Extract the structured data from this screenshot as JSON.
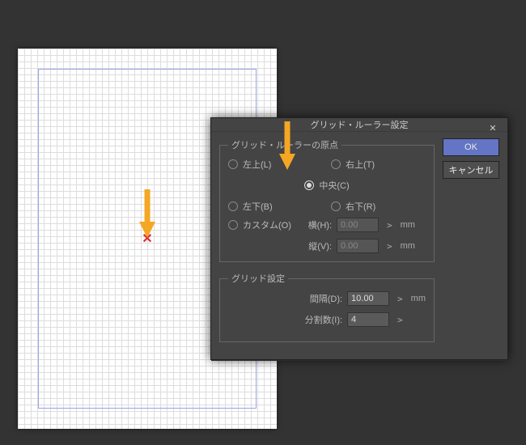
{
  "canvas": {
    "center_marker": "✕"
  },
  "dialog": {
    "title": "グリッド・ルーラー設定",
    "close_glyph": "✕",
    "ok_label": "OK",
    "cancel_label": "キャンセル",
    "origin_group": {
      "legend": "グリッド・ルーラーの原点",
      "options": {
        "top_left": "左上(L)",
        "top_right": "右上(T)",
        "center": "中央(C)",
        "bottom_left": "左下(B)",
        "bottom_right": "右下(R)",
        "custom": "カスタム(O)"
      },
      "selected": "center",
      "custom_h_label": "横(H):",
      "custom_v_label": "縦(V):",
      "custom_h_value": "0.00",
      "custom_v_value": "0.00",
      "unit": "mm"
    },
    "grid_group": {
      "legend": "グリッド設定",
      "spacing_label": "間隔(D):",
      "spacing_value": "10.00",
      "spacing_unit": "mm",
      "division_label": "分割数(I):",
      "division_value": "4"
    }
  }
}
